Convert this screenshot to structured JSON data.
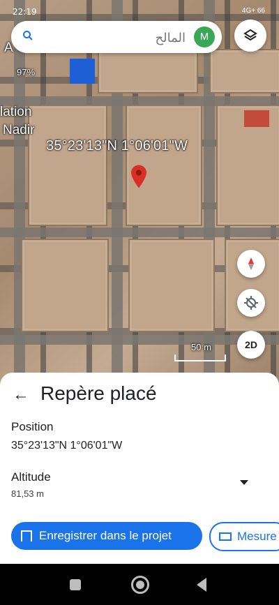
{
  "status_bar": {
    "time": "22:19",
    "right": "4G+ 66"
  },
  "search": {
    "placeholder": "المالح",
    "avatar_letter": "M"
  },
  "map": {
    "overlay_labels": {
      "percent": "97%",
      "station": "lation",
      "nadir": "Nadir",
      "letter_a": "A"
    },
    "coordinates": "35°23'13\"N 1°06'01\"W",
    "scale": "50 m",
    "mode_button": "2D"
  },
  "sheet": {
    "title": "Repère placé",
    "position_label": "Position",
    "position_value": "35°23'13\"N 1°06'01\"W",
    "altitude_label": "Altitude",
    "altitude_value": "81,53 m",
    "save_button": "Enregistrer dans le projet",
    "measure_button": "Mesure"
  },
  "icons": [
    "search-icon",
    "layers-icon",
    "compass-icon",
    "location-icon",
    "bookmark-icon",
    "ruler-icon",
    "back-arrow-icon",
    "dropdown-icon"
  ],
  "colors": {
    "accent": "#1a73e8",
    "avatar": "#3aa757",
    "pin": "#d93025"
  }
}
